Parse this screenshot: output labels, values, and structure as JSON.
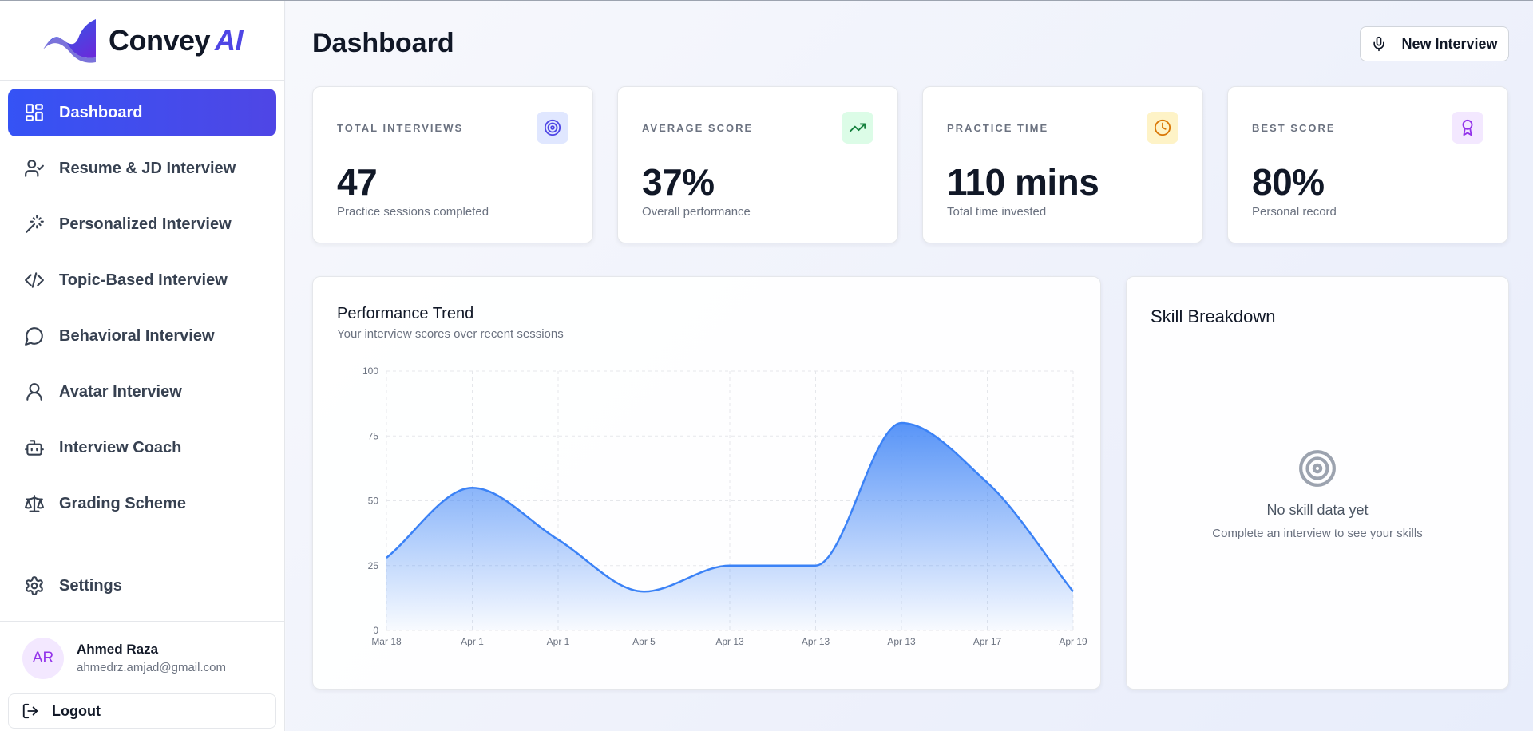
{
  "brand": {
    "name": "Convey",
    "suffix": "AI"
  },
  "page": {
    "title": "Dashboard"
  },
  "nav": {
    "items": [
      {
        "label": "Dashboard",
        "icon": "dashboard-grid-icon",
        "active": true
      },
      {
        "label": "Resume & JD Interview",
        "icon": "user-check-icon"
      },
      {
        "label": "Personalized Interview",
        "icon": "magic-wand-icon"
      },
      {
        "label": "Topic-Based Interview",
        "icon": "code-icon"
      },
      {
        "label": "Behavioral Interview",
        "icon": "chat-bubble-icon"
      },
      {
        "label": "Avatar Interview",
        "icon": "user-icon"
      },
      {
        "label": "Interview Coach",
        "icon": "robot-icon"
      },
      {
        "label": "Grading Scheme",
        "icon": "scale-icon"
      }
    ],
    "settings": {
      "label": "Settings",
      "icon": "gear-icon"
    }
  },
  "user": {
    "initials": "AR",
    "name": "Ahmed Raza",
    "email": "ahmedrz.amjad@gmail.com"
  },
  "logout": {
    "label": "Logout",
    "icon": "logout-icon"
  },
  "header": {
    "new_interview_label": "New Interview",
    "icon": "microphone-icon"
  },
  "stats": [
    {
      "label": "TOTAL INTERVIEWS",
      "value": "47",
      "sub": "Practice sessions completed",
      "icon": "target-icon",
      "icon_bg": "#e0e7ff",
      "icon_color": "#4f46e5"
    },
    {
      "label": "AVERAGE SCORE",
      "value": "37%",
      "sub": "Overall performance",
      "icon": "trending-up-icon",
      "icon_bg": "#dcfce7",
      "icon_color": "#15803d"
    },
    {
      "label": "PRACTICE TIME",
      "value": "110 mins",
      "sub": "Total time invested",
      "icon": "clock-icon",
      "icon_bg": "#fef3c7",
      "icon_color": "#d97706"
    },
    {
      "label": "BEST SCORE",
      "value": "80%",
      "sub": "Personal record",
      "icon": "award-icon",
      "icon_bg": "#f3e8ff",
      "icon_color": "#9333ea"
    }
  ],
  "performance": {
    "title": "Performance Trend",
    "subtitle": "Your interview scores over recent sessions"
  },
  "chart_data": {
    "type": "area",
    "categories": [
      "Mar 18",
      "Apr 1",
      "Apr 1",
      "Apr 5",
      "Apr 13",
      "Apr 13",
      "Apr 13",
      "Apr 17",
      "Apr 19"
    ],
    "values": [
      28,
      55,
      35,
      15,
      25,
      25,
      80,
      57,
      15
    ],
    "ylim": [
      0,
      100
    ],
    "yticks": [
      0,
      25,
      50,
      75,
      100
    ],
    "grid": true,
    "color": "#3b82f6"
  },
  "skills": {
    "title": "Skill Breakdown",
    "empty_title": "No skill data yet",
    "empty_subtitle": "Complete an interview to see your skills"
  }
}
